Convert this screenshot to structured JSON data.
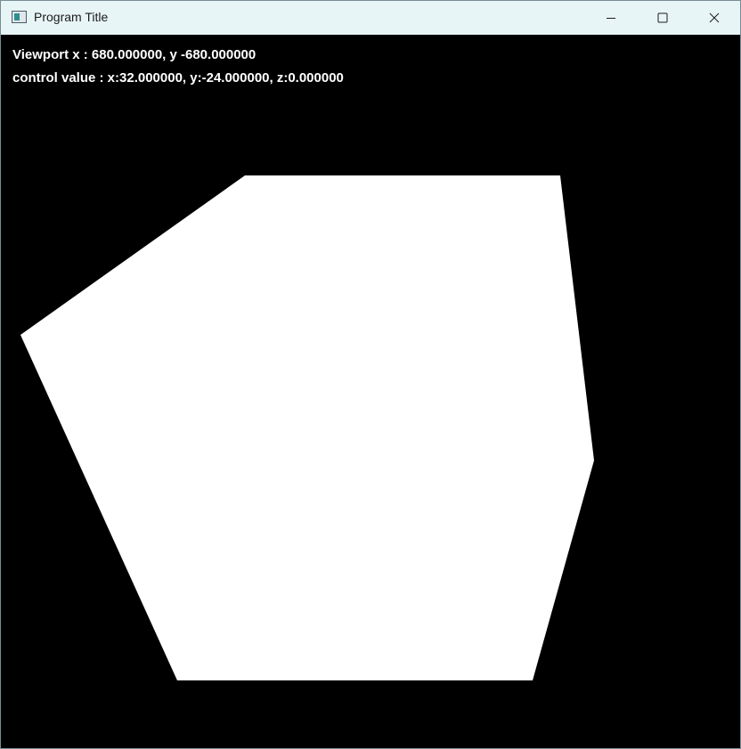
{
  "window": {
    "title": "Program Title"
  },
  "controls": {
    "minimize_icon": "minimize-icon",
    "maximize_icon": "maximize-icon",
    "close_icon": "close-icon"
  },
  "overlay": {
    "viewport_text": "Viewport x : 680.000000, y -680.000000",
    "control_text": "control value : x:32.000000, y:-24.000000, z:0.000000"
  },
  "canvas": {
    "background_color": "#000000",
    "shape_color": "#ffffff",
    "shape": "hexagon"
  }
}
